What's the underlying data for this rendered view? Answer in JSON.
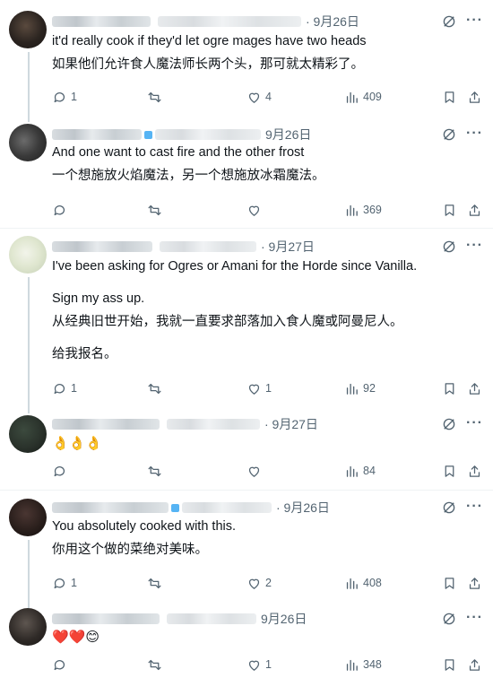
{
  "posts": [
    {
      "date": "· 9月26日",
      "lines": [
        "it'd really cook if they'd let ogre mages have two heads",
        "如果他们允许食人魔法师长两个头，那可就太精彩了。"
      ],
      "replies": "1",
      "reposts": "",
      "likes": "4",
      "views": "409"
    },
    {
      "date": "9月26日",
      "lines": [
        "And one want to cast fire and the other frost",
        "一个想施放火焰魔法，另一个想施放冰霜魔法。"
      ],
      "replies": "",
      "reposts": "",
      "likes": "",
      "views": "369"
    },
    {
      "date": "· 9月27日",
      "lines": [
        "I've been asking for Ogres or Amani for the Horde since Vanilla.",
        "",
        "Sign my ass up.",
        "从经典旧世开始，我就一直要求部落加入食人魔或阿曼尼人。",
        "",
        "给我报名。"
      ],
      "replies": "1",
      "reposts": "",
      "likes": "1",
      "views": "92"
    },
    {
      "date": "· 9月27日",
      "lines": [
        "👌👌👌"
      ],
      "replies": "",
      "reposts": "",
      "likes": "",
      "views": "84"
    },
    {
      "date": "· 9月26日",
      "lines": [
        "You absolutely cooked with this.",
        "你用这个做的菜绝对美味。"
      ],
      "replies": "1",
      "reposts": "",
      "likes": "2",
      "views": "408"
    },
    {
      "date": "9月26日",
      "lines": [
        "❤️❤️😊"
      ],
      "replies": "",
      "reposts": "",
      "likes": "1",
      "views": "348"
    }
  ],
  "icons": {
    "reply": "reply-icon",
    "repost": "repost-icon",
    "like": "like-icon",
    "views": "views-icon",
    "bookmark": "bookmark-icon",
    "share": "share-icon",
    "grok": "grok-icon",
    "more": "more-icon"
  },
  "colors": {
    "text": "#0f1419",
    "muted": "#536471",
    "divider": "#eff3f4",
    "thread": "#cfd9de",
    "accent": "#1d9bf0"
  }
}
